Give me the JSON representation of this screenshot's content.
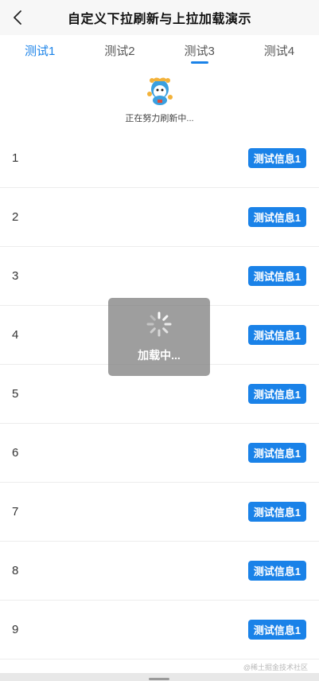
{
  "header": {
    "title": "自定义下拉刷新与上拉加载演示",
    "back_icon": "chevron-left-icon"
  },
  "tabs": [
    {
      "label": "测试1",
      "active": true
    },
    {
      "label": "测试2",
      "active": false
    },
    {
      "label": "测试3",
      "active": false,
      "indicator": true
    },
    {
      "label": "测试4",
      "active": false
    }
  ],
  "refresh": {
    "text": "正在努力刷新中..."
  },
  "rows": [
    {
      "num": "1",
      "badge": "测试信息1"
    },
    {
      "num": "2",
      "badge": "测试信息1"
    },
    {
      "num": "3",
      "badge": "测试信息1"
    },
    {
      "num": "4",
      "badge": "测试信息1"
    },
    {
      "num": "5",
      "badge": "测试信息1"
    },
    {
      "num": "6",
      "badge": "测试信息1"
    },
    {
      "num": "7",
      "badge": "测试信息1"
    },
    {
      "num": "8",
      "badge": "测试信息1"
    },
    {
      "num": "9",
      "badge": "测试信息1"
    }
  ],
  "toast": {
    "text": "加载中..."
  },
  "watermark": "@稀土掘金技术社区",
  "colors": {
    "accent": "#1a82e8",
    "nav_bg": "#f7f7f7"
  }
}
